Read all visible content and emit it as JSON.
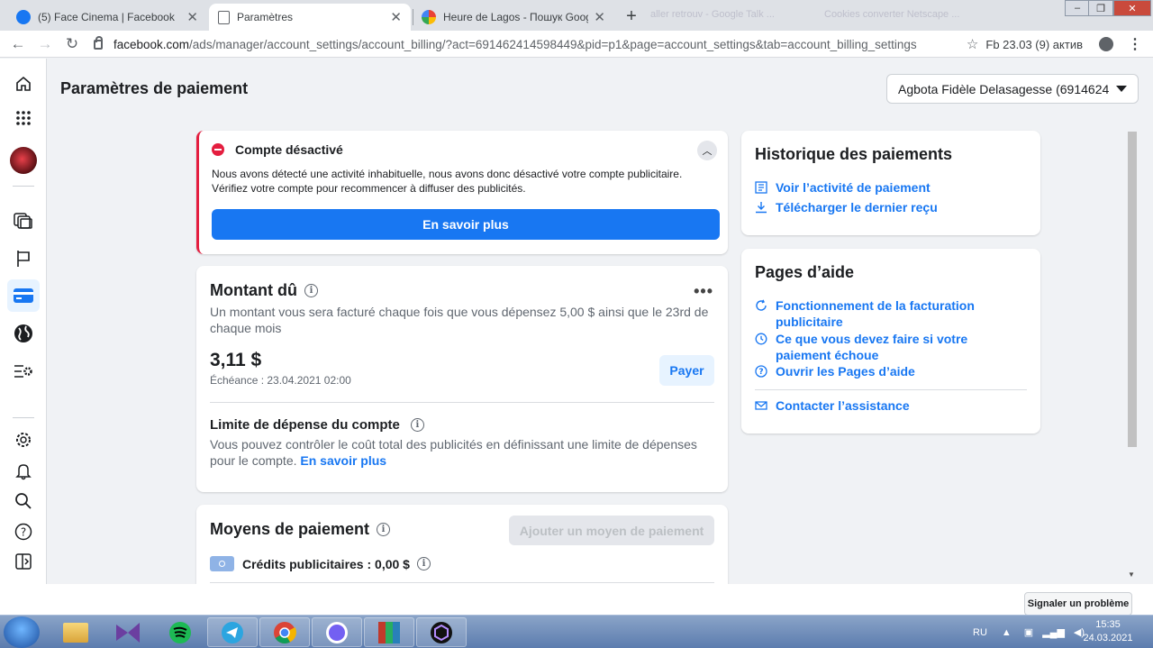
{
  "browser": {
    "tabs": [
      {
        "title": "(5) Face Cinema | Facebook",
        "favicon": "facebook-icon",
        "active": false
      },
      {
        "title": "Paramètres",
        "favicon": "page-icon",
        "active": true
      },
      {
        "title": "Heure de Lagos - Пошук Google",
        "favicon": "google-icon",
        "active": false
      }
    ],
    "ghost_tabs": [
      "aller retrouv - Google Talk ...",
      "Cookies converter Netscape ..."
    ],
    "url_host": "facebook.com",
    "url_path": "/ads/manager/account_settings/account_billing/?act=691462414598449&pid=p1&page=account_settings&tab=account_billing_settings",
    "profile_text": "Fb 23.03 (9) актив"
  },
  "page": {
    "title": "Paramètres de paiement",
    "account_selector": "Agbota Fidèle Delasagesse (6914624..."
  },
  "alert": {
    "title": "Compte désactivé",
    "body": "Nous avons détecté une activité inhabituelle, nous avons donc désactivé votre compte publicitaire. Vérifiez votre compte pour recommencer à diffuser des publicités.",
    "button": "En savoir plus"
  },
  "amount_due": {
    "title": "Montant dû",
    "description": "Un montant vous sera facturé chaque fois que vous dépensez 5,00 $ ainsi que le 23rd de chaque mois",
    "amount": "3,11 $",
    "due": "Échéance : 23.04.2021 02:00",
    "pay_button": "Payer",
    "limit_title": "Limite de dépense du compte",
    "limit_description": "Vous pouvez contrôler le coût total des publicités en définissant une limite de dépenses pour le compte.",
    "limit_link": "En savoir plus"
  },
  "payment_methods": {
    "title": "Moyens de paiement",
    "add_button": "Ajouter un moyen de paiement",
    "credits": "Crédits publicitaires : 0,00 $"
  },
  "history": {
    "title": "Historique des paiements",
    "links": [
      "Voir l’activité de paiement",
      "Télécharger le dernier reçu"
    ]
  },
  "help": {
    "title": "Pages d’aide",
    "links": [
      "Fonctionnement de la facturation publicitaire",
      "Ce que vous devez faire si votre paiement échoue",
      "Ouvrir les Pages d’aide"
    ],
    "contact": "Contacter l’assistance"
  },
  "report_button": "Signaler un problème",
  "taskbar": {
    "lang": "RU",
    "time": "15:35",
    "date": "24.03.2021"
  },
  "colors": {
    "accent": "#1877f2",
    "danger": "#e41e3f",
    "background": "#f0f2f5"
  }
}
